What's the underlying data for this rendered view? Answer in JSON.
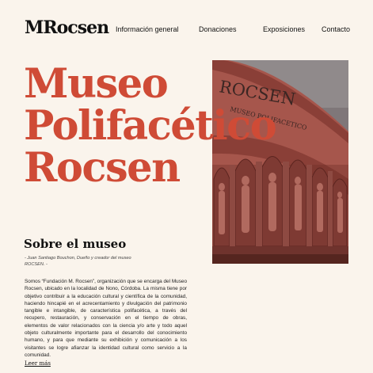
{
  "header": {
    "logo": "MRocsen",
    "nav": [
      "Información general",
      "Donaciones",
      "Exposiciones",
      "Contacto"
    ]
  },
  "hero": {
    "title_lines": [
      "Museo",
      "Polifacético",
      "Rocsen"
    ],
    "photo_sign_lines": [
      "ROCSEN",
      "MUSEO POLIFACETICO"
    ]
  },
  "about": {
    "title": "Sobre el museo",
    "quote": "- Juan Santiago Bouchon, Dueño y creador del museo ROCSEN. -",
    "body": "Somos “Fundación M. Rocsen”, organización que se encarga del Museo Rocsen, ubicado en la localidad de Nono, Córdoba. La misma tiene por objetivo contribuir a la educación cultural y científica de la comunidad, haciendo hincapié en el acrecentamiento y divulgación del patrimonio tangible e intangible, de característica polifacética, a través del recupero, restauración, y conservación en el tiempo de obras, elementos de valor relacionados con la ciencia y/o arte y todo aquel objeto culturalmente importante para el desarrollo del conocimiento humano, y para que mediante su exhibición y comunicación a los visitantes se logre afianzar la identidad cultural como servicio a la comunidad.",
    "read_more": "Leer más"
  },
  "colors": {
    "accent": "#cf4b36",
    "background": "#faf4ec"
  }
}
